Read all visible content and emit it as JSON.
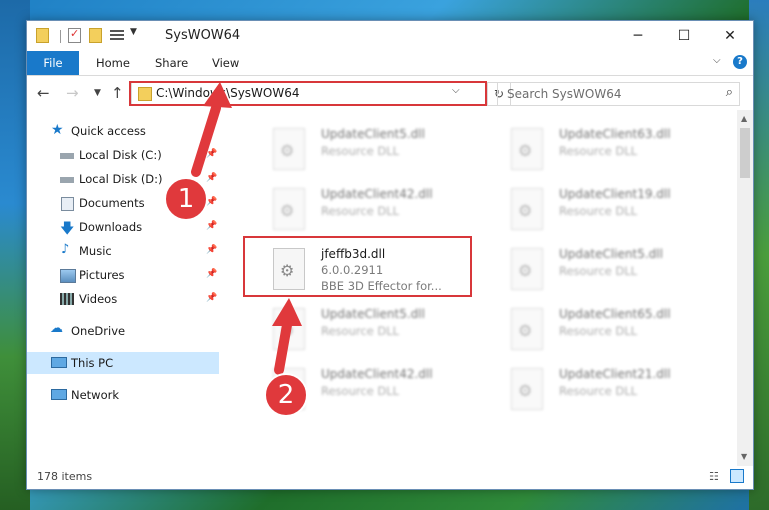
{
  "window": {
    "title": "SysWOW64"
  },
  "ribbon": {
    "file": "File",
    "home": "Home",
    "share": "Share",
    "view": "View"
  },
  "address": {
    "path": "C:\\Windows\\SysWOW64"
  },
  "search": {
    "placeholder": "Search SysWOW64"
  },
  "sidebar": {
    "items": [
      {
        "label": "Quick access"
      },
      {
        "label": "Local Disk (C:)"
      },
      {
        "label": "Local Disk (D:)"
      },
      {
        "label": "Documents"
      },
      {
        "label": "Downloads"
      },
      {
        "label": "Music"
      },
      {
        "label": "Pictures"
      },
      {
        "label": "Videos"
      },
      {
        "label": "OneDrive"
      },
      {
        "label": "This PC"
      },
      {
        "label": "Network"
      }
    ]
  },
  "files": [
    {
      "name": "UpdateClient5.dll",
      "desc": "Resource DLL"
    },
    {
      "name": "UpdateClient63.dll",
      "desc": "Resource DLL"
    },
    {
      "name": "UpdateClient42.dll",
      "desc": "Resource DLL"
    },
    {
      "name": "UpdateClient19.dll",
      "desc": "Resource DLL"
    },
    {
      "name": "jfeffb3d.dll",
      "version": "6.0.0.2911",
      "desc": "BBE 3D Effector for..."
    },
    {
      "name": "UpdateClient5.dll",
      "desc": "Resource DLL"
    },
    {
      "name": "UpdateClient5.dll",
      "desc": "Resource DLL"
    },
    {
      "name": "UpdateClient65.dll",
      "desc": "Resource DLL"
    },
    {
      "name": "UpdateClient42.dll",
      "desc": "Resource DLL"
    },
    {
      "name": "UpdateClient21.dll",
      "desc": "Resource DLL"
    }
  ],
  "status": {
    "count": "178 items"
  },
  "annotations": {
    "step1": "1",
    "step2": "2"
  },
  "colors": {
    "accent": "#1979ca",
    "highlight": "#d8373a"
  }
}
